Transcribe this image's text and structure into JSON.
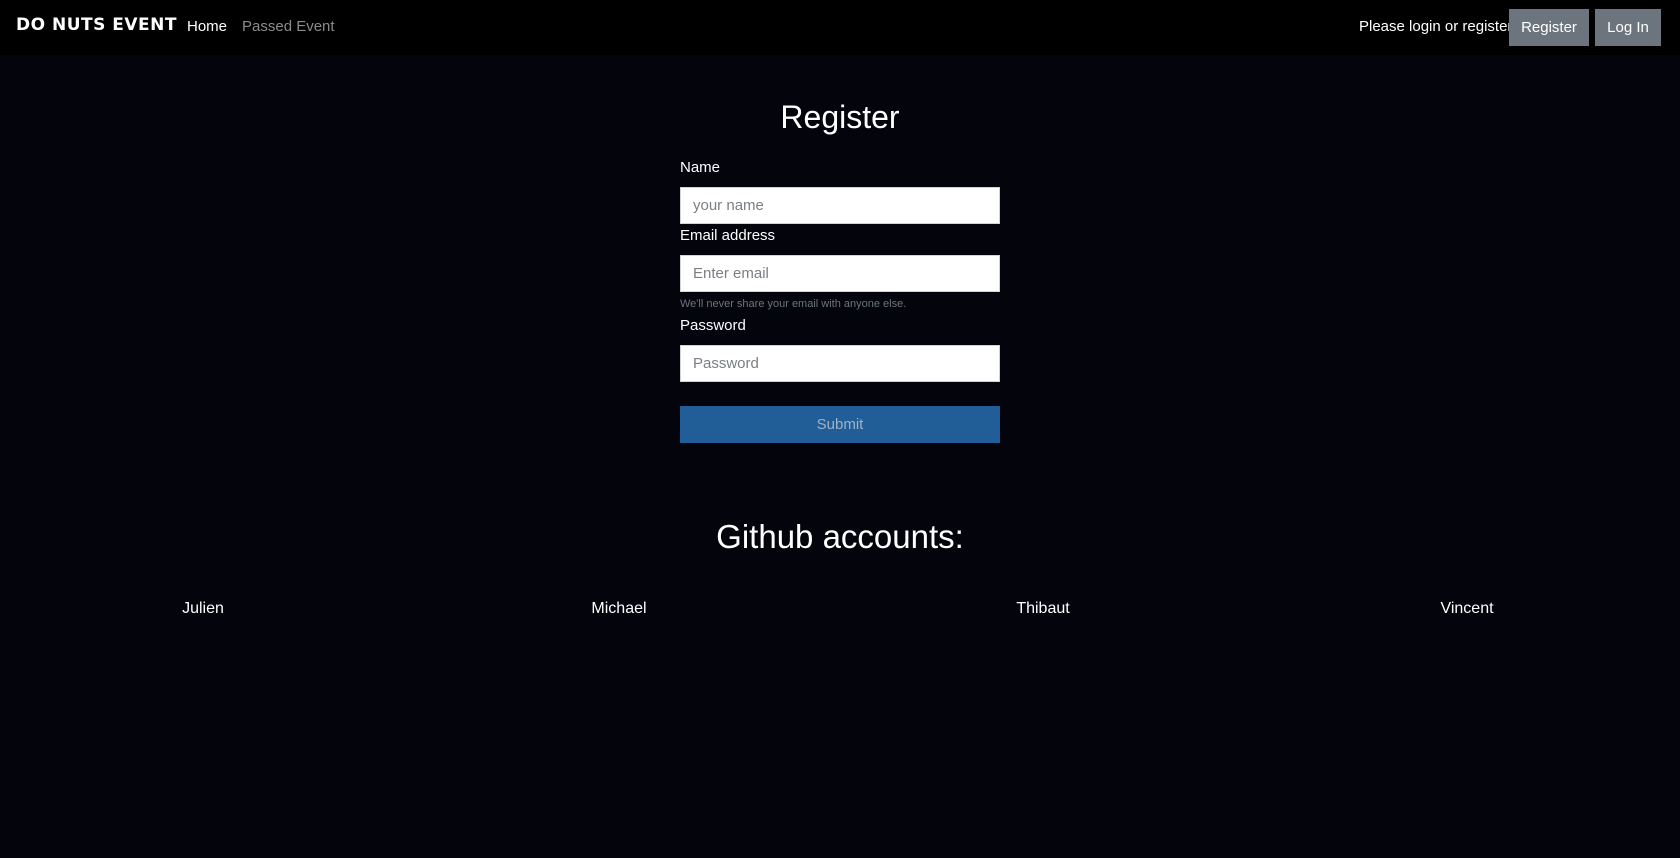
{
  "navbar": {
    "brand": "DO NUTS EVENT",
    "links": [
      "Home",
      "Passed Event"
    ],
    "message": "Please login or register",
    "register_label": "Register",
    "login_label": "Log In"
  },
  "form": {
    "title": "Register",
    "name_label": "Name",
    "name_placeholder": "your name",
    "email_label": "Email address",
    "email_placeholder": "Enter email",
    "email_help": "We'll never share your email with anyone else.",
    "password_label": "Password",
    "password_placeholder": "Password",
    "submit_label": "Submit"
  },
  "github": {
    "title": "Github accounts:",
    "accounts": [
      "Julien",
      "Michael",
      "Thibaut",
      "Vincent"
    ]
  },
  "colors": {
    "background": "#04040d",
    "navbar": "#000000",
    "secondary_button": "#6c757d",
    "primary_button": "#215d96"
  }
}
